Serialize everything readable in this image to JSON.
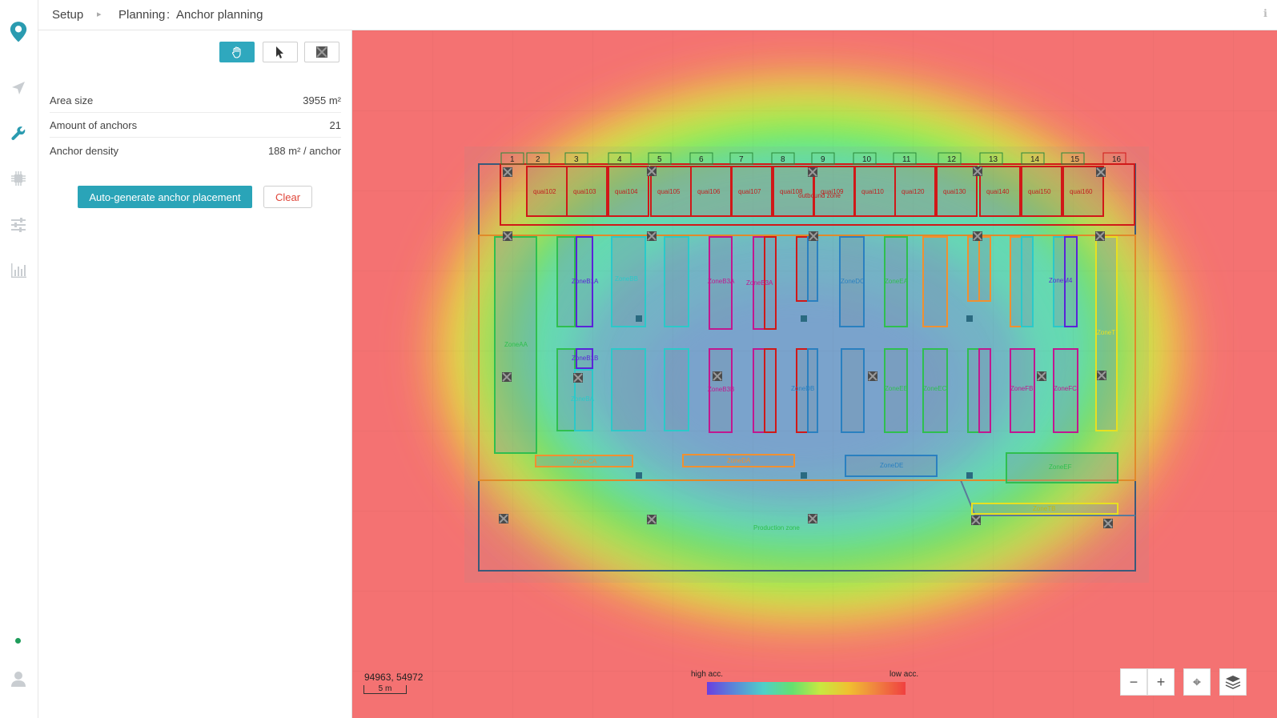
{
  "breadcrumb": {
    "root": "Setup",
    "section": "Planning",
    "separator": ":",
    "page": "Anchor planning"
  },
  "rail": {
    "items": [
      {
        "name": "logo-pin-icon"
      },
      {
        "name": "navigation-arrow-icon"
      },
      {
        "name": "wrench-icon"
      },
      {
        "name": "chip-icon"
      },
      {
        "name": "sliders-icon"
      },
      {
        "name": "bar-chart-icon"
      }
    ],
    "status_color": "#1e9c5a",
    "user_icon": "user-icon"
  },
  "tools": [
    {
      "name": "pan-hand-icon",
      "active": true
    },
    {
      "name": "pointer-cursor-icon",
      "active": false
    },
    {
      "name": "anchor-square-icon",
      "active": false
    }
  ],
  "stats": [
    {
      "label": "Area size",
      "value": "3955 m²"
    },
    {
      "label": "Amount of anchors",
      "value": "21"
    },
    {
      "label": "Anchor density",
      "value": "188 m² / anchor"
    }
  ],
  "actions": {
    "auto_generate": "Auto-generate anchor placement",
    "clear": "Clear"
  },
  "map": {
    "coords": "94963, 54972",
    "scale": "5 m",
    "legend_high": "high acc.",
    "legend_low": "low acc.",
    "dock_numbers": [
      "1",
      "2",
      "3",
      "4",
      "5",
      "6",
      "7",
      "8",
      "9",
      "10",
      "11",
      "12",
      "13",
      "14",
      "15",
      "16"
    ],
    "quai_labels": [
      "quai102",
      "quai103",
      "quai104",
      "quai105",
      "quai106",
      "quai107",
      "quai108",
      "quai109",
      "quai110",
      "quai120",
      "quai130",
      "quai140",
      "quai150",
      "quai160"
    ],
    "outbound_label": "outbound zone",
    "zones_upper": [
      "ZoneAA",
      "ZoneB1A",
      "ZoneBB",
      "ZoneB3A",
      "ZoneB3A",
      "ZoneDC",
      "ZoneEA",
      "ZoneM4",
      "ZoneT"
    ],
    "zones_lower": [
      "ZoneB1B",
      "ZoneBA",
      "ZoneB3B",
      "ZoneDB",
      "ZoneEB",
      "ZoneEC",
      "ZoneFB",
      "ZoneFC",
      "ZoneDE",
      "ZoneEF",
      "ZoneTB",
      "ZoneCA",
      "ZoneDA"
    ],
    "production_label": "Production zone",
    "buttons": [
      {
        "name": "zoom-out-button",
        "icon": "−"
      },
      {
        "name": "zoom-in-button",
        "icon": "+"
      },
      {
        "name": "recenter-button",
        "icon": "⌖"
      },
      {
        "name": "layers-button",
        "icon": "layers-icon"
      }
    ]
  }
}
